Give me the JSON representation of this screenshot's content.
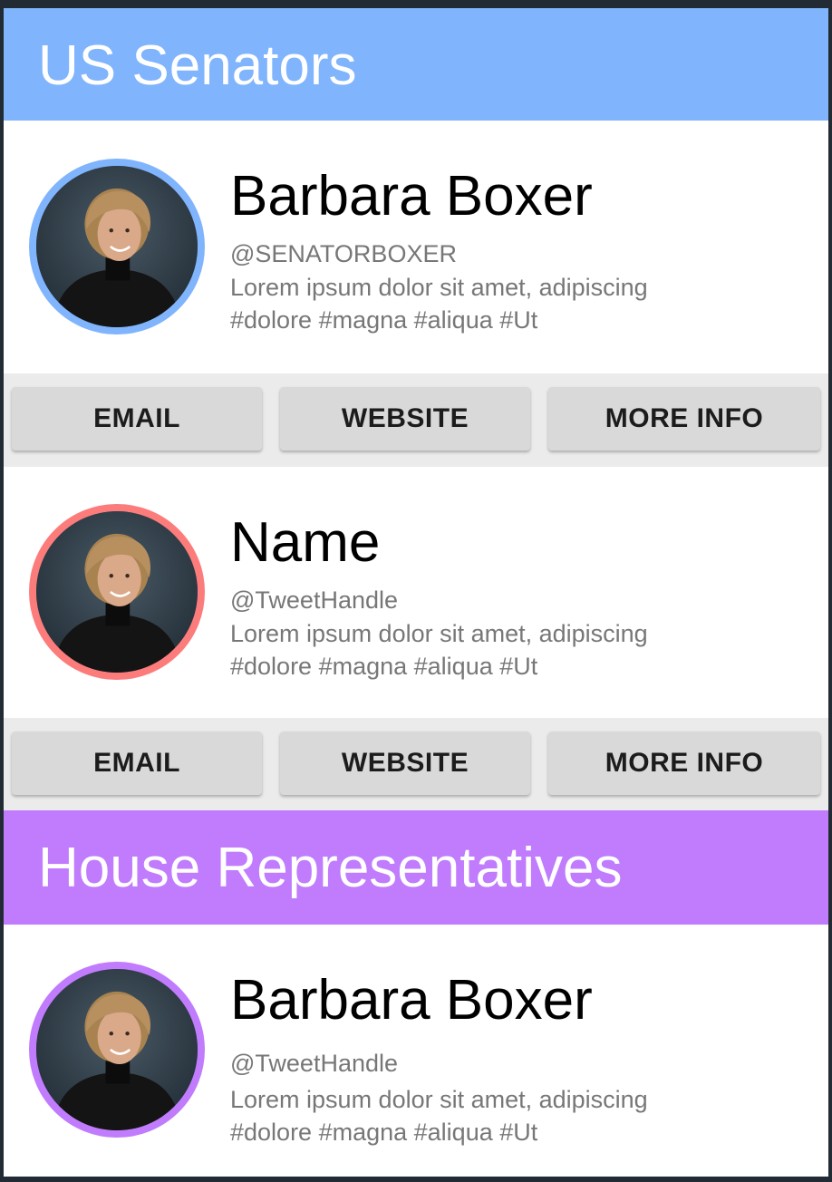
{
  "colors": {
    "senate_header": "#80b4fc",
    "house_header": "#c07cfc",
    "ring_blue": "#80b4fc",
    "ring_red": "#fc7c7c",
    "ring_purple": "#c07cfc"
  },
  "senate": {
    "title": "US Senators",
    "cards": [
      {
        "name": "Barbara Boxer",
        "handle": "@SENATORBOXER",
        "bio_line1": "Lorem ipsum dolor sit amet, adipiscing",
        "bio_line2": "#dolore #magna #aliqua #Ut",
        "avatar": "senator-portrait-photo",
        "ring_color": "#80b4fc",
        "actions": {
          "email": "EMAIL",
          "website": "WEBSITE",
          "more_info": "MORE INFO"
        }
      },
      {
        "name": "Name",
        "handle": "@TweetHandle",
        "bio_line1": "Lorem ipsum dolor sit amet, adipiscing",
        "bio_line2": "#dolore #magna #aliqua #Ut",
        "avatar": "senator-portrait-photo",
        "ring_color": "#fc7c7c",
        "actions": {
          "email": "EMAIL",
          "website": "WEBSITE",
          "more_info": "MORE INFO"
        }
      }
    ]
  },
  "house": {
    "title": "House Representatives",
    "cards": [
      {
        "name": "Barbara Boxer",
        "handle": "@TweetHandle",
        "bio_line1": "Lorem ipsum dolor sit amet, adipiscing",
        "bio_line2": "#dolore #magna #aliqua #Ut",
        "avatar": "senator-portrait-photo",
        "ring_color": "#c07cfc"
      }
    ]
  }
}
